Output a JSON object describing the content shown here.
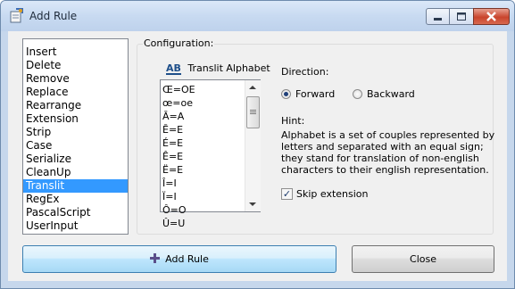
{
  "window": {
    "title": "Add Rule",
    "title_icon": "rule-wizard-icon"
  },
  "caption": {
    "minimize_icon": "minimize-icon",
    "maximize_icon": "maximize-icon",
    "close_icon": "close-icon"
  },
  "rules": {
    "items": [
      "Insert",
      "Delete",
      "Remove",
      "Replace",
      "Rearrange",
      "Extension",
      "Strip",
      "Case",
      "Serialize",
      "CleanUp",
      "Translit",
      "RegEx",
      "PascalScript",
      "UserInput"
    ],
    "selected": "Translit"
  },
  "config": {
    "label": "Configuration:",
    "alphabet": {
      "icon_text": "AB",
      "header": "Translit Alphabet",
      "items": [
        "Œ=OE",
        "œ=oe",
        "Ā=A",
        "Ē=E",
        "É=E",
        "Ê=E",
        "Ë=E",
        "Î=I",
        "Ï=I",
        "Ô=O",
        "Û=U"
      ]
    },
    "direction": {
      "label": "Direction:",
      "forward": "Forward",
      "backward": "Backward",
      "selected": "Forward"
    },
    "hint": {
      "label": "Hint:",
      "text": "Alphabet is a set of couples represented by letters and separated with an equal sign; they stand for translation of non-english characters to their english representation."
    },
    "skip_extension": {
      "label": "Skip extension",
      "checked": true
    }
  },
  "buttons": {
    "add": "Add Rule",
    "close": "Close"
  }
}
